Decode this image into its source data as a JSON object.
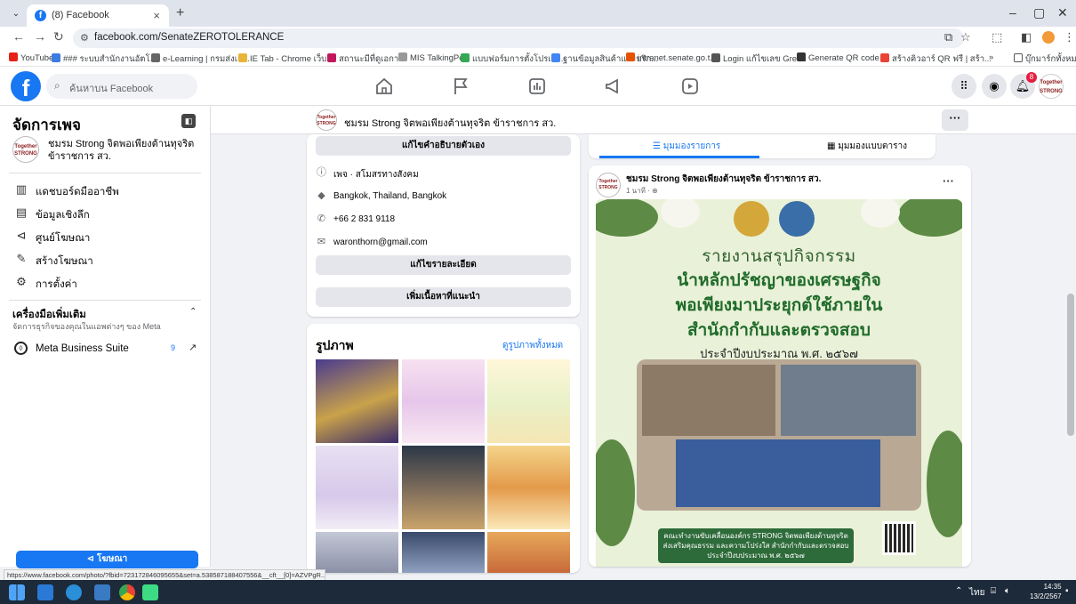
{
  "browser": {
    "tab_title": "(8) Facebook",
    "tab_close": "×",
    "new_tab": "+",
    "url": "facebook.com/SenateZEROTOLERANCE",
    "window_controls": [
      "–",
      "▢",
      "✕"
    ],
    "bookmarks": [
      "YouTube",
      "### ระบบสำนักงานอัตโ...",
      "e-Learning | กรมส่งเส...",
      "IE Tab - Chrome เว็บ...",
      "สถานะมีที่ดูเอกา",
      "MIS TalkingPen",
      "แบบฟอร์มการตั้งโปรแก...",
      "ฐานข้อมูลสินค้าและบริก...",
      "intranet.senate.go.t...",
      "Login แก้ไขเลข Green",
      "Generate QR code",
      "สร้างคิวอาร์ QR ฟรี | สร้า...",
      "»",
      "บุ๊กมาร์กทั้งหมด"
    ]
  },
  "fb": {
    "search_placeholder": "ค้นหาบน Facebook",
    "notification_count": "8",
    "avatar_text": "Together STRONG"
  },
  "sidebar": {
    "title": "จัดการเพจ",
    "page_name": "ชมรม Strong จิตพอเพียงต้านทุจริต ข้าราชการ สว.",
    "items": [
      {
        "label": "แดชบอร์ดมืออาชีพ",
        "icon": "dashboard-icon"
      },
      {
        "label": "ข้อมูลเชิงลึก",
        "icon": "insights-icon"
      },
      {
        "label": "ศูนย์โฆษณา",
        "icon": "megaphone-icon"
      },
      {
        "label": "สร้างโฆษณา",
        "icon": "edit-icon"
      },
      {
        "label": "การตั้งค่า",
        "icon": "gear-icon"
      }
    ],
    "tools_title": "เครื่องมือเพิ่มเติม",
    "tools_subtitle": "จัดการธุรกิจของคุณในแอพต่างๆ ของ Meta",
    "meta_suite": "Meta Business Suite",
    "meta_count": "9",
    "promote_label": "โฆษณา"
  },
  "pagebar": {
    "name": "ชมรม Strong จิตพอเพียงต้านทุจริต ข้าราชการ สว.",
    "more": "···"
  },
  "intro": {
    "edit_bio": "แก้ไขคำอธิบายตัวเอง",
    "category": "เพจ · สโมสรทางสังคม",
    "location": "Bangkok, Thailand, Bangkok",
    "phone": "+66 2 831 9118",
    "email": "waronthorn@gmail.com",
    "edit_details": "แก้ไขรายละเอียด",
    "add_featured": "เพิ่มเนื้อหาที่แนะนำ"
  },
  "photos": {
    "title": "รูปภาพ",
    "see_all": "ดูรูปภาพทั้งหมด"
  },
  "feed": {
    "list_view": "มุมมองรายการ",
    "grid_view": "มุมมองแบบตาราง",
    "post_author": "ชมรม Strong จิตพอเพียงต้านทุจริต ข้าราชการ สว.",
    "post_time": "1 นาที · ",
    "post_more": "···",
    "image": {
      "line1": "รายงานสรุปกิจกรรม",
      "line2": "นำหลักปรัชญาของเศรษฐกิจ",
      "line3": "พอเพียงมาประยุกต์ใช้ภายใน",
      "line4": "สำนักกำกับและตรวจสอบ",
      "line5": "ประจำปีงบประมาณ พ.ศ. ๒๕๖๗",
      "footer": "คณะทำงานขับเคลื่อนองค์กร STRONG จิตพอเพียงต้านทุจริต ส่งเสริมคุณธรรม และความโปร่งใส สำนักกำกับและตรวจสอบ ประจำปีงบประมาณ พ.ศ. ๒๕๖๗"
    }
  },
  "status_url": "https://www.facebook.com/photo/?fbid=723172846095655&set=a.538587188407556&__cft__[0]=AZVPgR...",
  "taskbar": {
    "time": "14:35",
    "date": "13/2/2567",
    "lang": "ไทย"
  },
  "colors": {
    "facebook_blue": "#1877f2",
    "notification_red": "#e41e3f",
    "poster_green": "#1f6b2a"
  }
}
